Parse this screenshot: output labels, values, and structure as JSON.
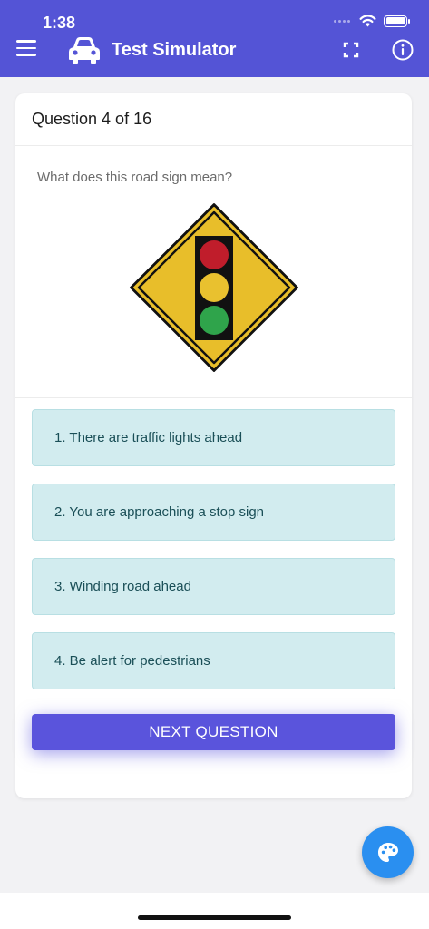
{
  "status": {
    "time": "1:38"
  },
  "appbar": {
    "title": "Test Simulator",
    "menu_icon": "hamburger-menu-icon",
    "car_icon": "car-icon",
    "fullscreen_icon": "fullscreen-icon",
    "info_icon": "info-icon"
  },
  "question": {
    "header": "Question 4 of 16",
    "prompt": "What does this road sign mean?",
    "sign": "traffic-signal-ahead-sign"
  },
  "options": [
    {
      "label": "1. There are traffic lights ahead"
    },
    {
      "label": "2. You are approaching a stop sign"
    },
    {
      "label": "3. Winding road ahead"
    },
    {
      "label": "4. Be alert for pedestrians"
    }
  ],
  "next_button": {
    "label": "NEXT QUESTION"
  },
  "fab": {
    "icon": "palette-icon"
  },
  "colors": {
    "appbar": "#5454d6",
    "option_bg": "#d2ecef",
    "option_text": "#1a4f57",
    "next_button": "#5a54dc",
    "fab": "#2a8ff0",
    "sign_yellow": "#e8be2a"
  }
}
